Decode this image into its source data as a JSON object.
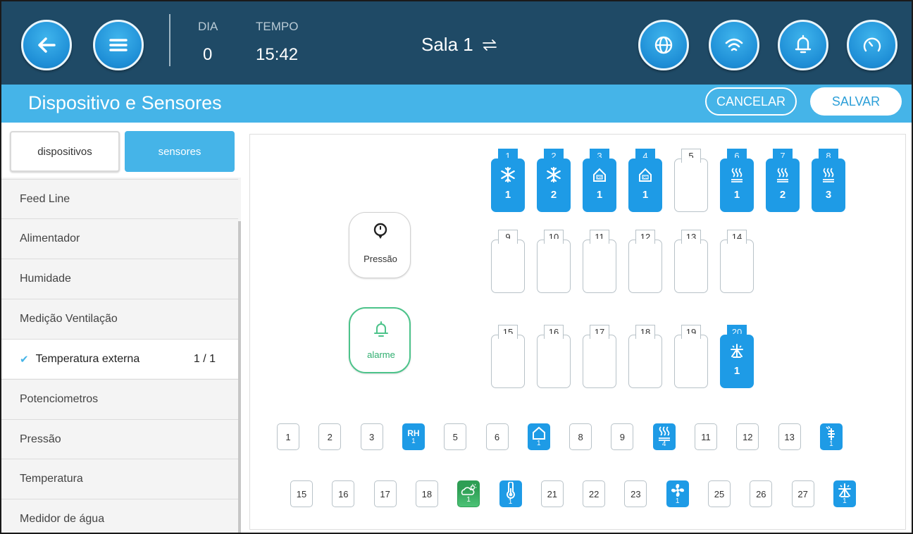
{
  "header": {
    "day_label": "DIA",
    "day_value": "0",
    "time_label": "TEMPO",
    "time_value": "15:42",
    "room": "Sala 1",
    "room_switch_icon": "swap-arrows-icon",
    "icons": [
      "back-arrow-icon",
      "menu-icon",
      "globe-icon",
      "wifi-icon",
      "bell-icon",
      "gauge-icon"
    ]
  },
  "titlebar": {
    "title": "Dispositivo e Sensores",
    "cancel": "CANCELAR",
    "save": "SALVAR"
  },
  "sidebar": {
    "toggle_devices": "dispositivos",
    "toggle_sensors": "sensores",
    "active_toggle": "sensores",
    "items": [
      {
        "label": "Feed Line",
        "count": ""
      },
      {
        "label": "Alimentador",
        "count": ""
      },
      {
        "label": "Humidade",
        "count": ""
      },
      {
        "label": "Medição Ventilação",
        "count": ""
      },
      {
        "label": "Temperatura externa",
        "count": "1 / 1",
        "selected": true
      },
      {
        "label": "Potenciometros",
        "count": ""
      },
      {
        "label": "Pressão",
        "count": ""
      },
      {
        "label": "Temperatura",
        "count": ""
      },
      {
        "label": "Medidor de água",
        "count": ""
      }
    ]
  },
  "cards": {
    "pressure": "Pressão",
    "alarm": "alarme"
  },
  "relay_slots": [
    {
      "n": "1",
      "active": true,
      "icon": "snowflake-icon",
      "sub": "1"
    },
    {
      "n": "2",
      "active": true,
      "icon": "snowflake-icon",
      "sub": "2"
    },
    {
      "n": "3",
      "active": true,
      "icon": "inlet-op-icon",
      "sub": "1"
    },
    {
      "n": "4",
      "active": true,
      "icon": "inlet-cl-icon",
      "sub": "1"
    },
    {
      "n": "5",
      "active": false
    },
    {
      "n": "6",
      "active": true,
      "icon": "heater-icon",
      "sub": "1"
    },
    {
      "n": "7",
      "active": true,
      "icon": "heater-icon",
      "sub": "2"
    },
    {
      "n": "8",
      "active": true,
      "icon": "heater-icon",
      "sub": "3"
    },
    {
      "n": "9",
      "active": false
    },
    {
      "n": "10",
      "active": false
    },
    {
      "n": "11",
      "active": false
    },
    {
      "n": "12",
      "active": false
    },
    {
      "n": "13",
      "active": false
    },
    {
      "n": "14",
      "active": false
    },
    {
      "n": "15",
      "active": false
    },
    {
      "n": "16",
      "active": false
    },
    {
      "n": "17",
      "active": false
    },
    {
      "n": "18",
      "active": false
    },
    {
      "n": "19",
      "active": false
    },
    {
      "n": "20",
      "active": true,
      "icon": "sprinkler-icon",
      "sub": "1"
    }
  ],
  "analog_row1": [
    {
      "n": "1"
    },
    {
      "n": "2"
    },
    {
      "n": "3"
    },
    {
      "n": "",
      "text": "RH",
      "sub": "1",
      "color": "blue"
    },
    {
      "n": "5"
    },
    {
      "n": "6"
    },
    {
      "n": "",
      "icon": "inlet-icon",
      "sub": "1",
      "color": "blue"
    },
    {
      "n": "8"
    },
    {
      "n": "9"
    },
    {
      "n": "",
      "icon": "heater-icon",
      "sub": "4",
      "color": "blue"
    },
    {
      "n": "11"
    },
    {
      "n": "12"
    },
    {
      "n": "13"
    },
    {
      "n": "",
      "icon": "fogger-icon",
      "sub": "1",
      "color": "blue"
    }
  ],
  "analog_row2": [
    {
      "n": "15"
    },
    {
      "n": "16"
    },
    {
      "n": "17"
    },
    {
      "n": "18"
    },
    {
      "n": "",
      "icon": "outside-weather-icon",
      "sub": "1",
      "color": "green"
    },
    {
      "n": "",
      "icon": "thermometer-icon",
      "sub": "1",
      "color": "blue"
    },
    {
      "n": "21"
    },
    {
      "n": "22"
    },
    {
      "n": "23"
    },
    {
      "n": "",
      "icon": "fan-icon",
      "sub": "1",
      "color": "blue"
    },
    {
      "n": "25"
    },
    {
      "n": "26"
    },
    {
      "n": "27"
    },
    {
      "n": "",
      "icon": "sprinkler-icon",
      "sub": "1",
      "color": "blue"
    }
  ],
  "colors": {
    "topbar": "#1f4a66",
    "accent": "#45b4e8",
    "active_slot": "#1e9be6",
    "alarm_green": "#4cc38a"
  }
}
